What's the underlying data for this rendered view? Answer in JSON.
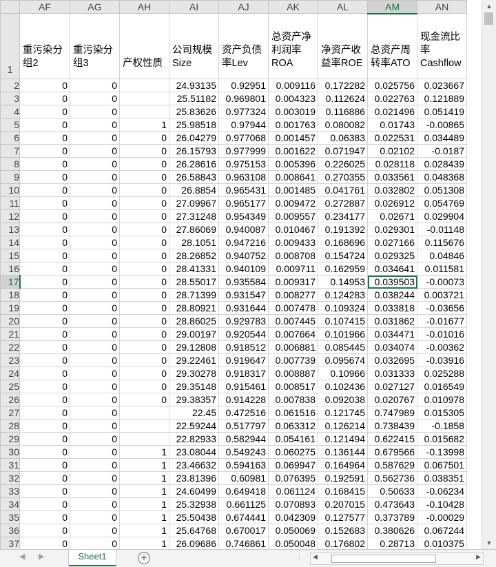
{
  "columns": [
    "AF",
    "AG",
    "AH",
    "AI",
    "AJ",
    "AK",
    "AL",
    "AM",
    "AN"
  ],
  "active_column": "AM",
  "active_row": "17",
  "header_row": {
    "row_label": "1",
    "cells": [
      "重污染分组2",
      "重污染分组3",
      "产权性质",
      "公司规模Size",
      "资产负债率Lev",
      "总资产净利润率ROA",
      "净资产收益率ROE",
      "总资产周转率ATO",
      "现金流比率Cashflow"
    ]
  },
  "rows": [
    {
      "n": "2",
      "cells": [
        "0",
        "0",
        "",
        "24.93135",
        "0.92951",
        "0.009116",
        "0.172282",
        "0.025756",
        "0.023667"
      ]
    },
    {
      "n": "3",
      "cells": [
        "0",
        "0",
        "",
        "25.51182",
        "0.969801",
        "0.004323",
        "0.112624",
        "0.022763",
        "0.121889"
      ]
    },
    {
      "n": "4",
      "cells": [
        "0",
        "0",
        "",
        "25.83626",
        "0.977324",
        "0.003019",
        "0.116886",
        "0.021496",
        "0.051419"
      ]
    },
    {
      "n": "5",
      "cells": [
        "0",
        "0",
        "1",
        "25.98518",
        "0.97944",
        "0.001763",
        "0.080082",
        "0.01743",
        "-0.00865"
      ]
    },
    {
      "n": "6",
      "cells": [
        "0",
        "0",
        "0",
        "26.04279",
        "0.977068",
        "0.001457",
        "0.06383",
        "0.022531",
        "0.034489"
      ]
    },
    {
      "n": "7",
      "cells": [
        "0",
        "0",
        "0",
        "26.15793",
        "0.977999",
        "0.001622",
        "0.071947",
        "0.02102",
        "-0.0187"
      ]
    },
    {
      "n": "8",
      "cells": [
        "0",
        "0",
        "0",
        "26.28616",
        "0.975153",
        "0.005396",
        "0.226025",
        "0.028118",
        "0.028439"
      ]
    },
    {
      "n": "9",
      "cells": [
        "0",
        "0",
        "0",
        "26.58843",
        "0.963108",
        "0.008641",
        "0.270355",
        "0.033561",
        "0.048368"
      ]
    },
    {
      "n": "10",
      "cells": [
        "0",
        "0",
        "0",
        "26.8854",
        "0.965431",
        "0.001485",
        "0.041761",
        "0.032802",
        "0.051308"
      ]
    },
    {
      "n": "11",
      "cells": [
        "0",
        "0",
        "0",
        "27.09967",
        "0.965177",
        "0.009472",
        "0.272887",
        "0.026912",
        "0.054769"
      ]
    },
    {
      "n": "12",
      "cells": [
        "0",
        "0",
        "0",
        "27.31248",
        "0.954349",
        "0.009557",
        "0.234177",
        "0.02671",
        "0.029904"
      ]
    },
    {
      "n": "13",
      "cells": [
        "0",
        "0",
        "0",
        "27.86069",
        "0.940087",
        "0.010467",
        "0.191392",
        "0.029301",
        "-0.01148"
      ]
    },
    {
      "n": "14",
      "cells": [
        "0",
        "0",
        "0",
        "28.1051",
        "0.947216",
        "0.009433",
        "0.168696",
        "0.027166",
        "0.115676"
      ]
    },
    {
      "n": "15",
      "cells": [
        "0",
        "0",
        "0",
        "28.26852",
        "0.940752",
        "0.008708",
        "0.154724",
        "0.029325",
        "0.04846"
      ]
    },
    {
      "n": "16",
      "cells": [
        "0",
        "0",
        "0",
        "28.41331",
        "0.940109",
        "0.009711",
        "0.162959",
        "0.034641",
        "0.011581"
      ]
    },
    {
      "n": "17",
      "cells": [
        "0",
        "0",
        "0",
        "28.55017",
        "0.935584",
        "0.009317",
        "0.14953",
        "0.039503",
        "-0.00073"
      ]
    },
    {
      "n": "18",
      "cells": [
        "0",
        "0",
        "0",
        "28.71399",
        "0.931547",
        "0.008277",
        "0.124283",
        "0.038244",
        "0.003721"
      ]
    },
    {
      "n": "19",
      "cells": [
        "0",
        "0",
        "0",
        "28.80921",
        "0.931644",
        "0.007478",
        "0.109324",
        "0.033818",
        "-0.03656"
      ]
    },
    {
      "n": "20",
      "cells": [
        "0",
        "0",
        "0",
        "28.86025",
        "0.929783",
        "0.007445",
        "0.107415",
        "0.031862",
        "-0.01677"
      ]
    },
    {
      "n": "21",
      "cells": [
        "0",
        "0",
        "0",
        "29.00197",
        "0.920544",
        "0.007664",
        "0.101966",
        "0.034471",
        "-0.01016"
      ]
    },
    {
      "n": "22",
      "cells": [
        "0",
        "0",
        "0",
        "29.12808",
        "0.918512",
        "0.006881",
        "0.085445",
        "0.034074",
        "-0.00362"
      ]
    },
    {
      "n": "23",
      "cells": [
        "0",
        "0",
        "0",
        "29.22461",
        "0.919647",
        "0.007739",
        "0.095674",
        "0.032695",
        "-0.03916"
      ]
    },
    {
      "n": "24",
      "cells": [
        "0",
        "0",
        "0",
        "29.30278",
        "0.918317",
        "0.008887",
        "0.10966",
        "0.031333",
        "0.025288"
      ]
    },
    {
      "n": "25",
      "cells": [
        "0",
        "0",
        "0",
        "29.35148",
        "0.915461",
        "0.008517",
        "0.102436",
        "0.027127",
        "0.016549"
      ]
    },
    {
      "n": "26",
      "cells": [
        "0",
        "0",
        "0",
        "29.38357",
        "0.914228",
        "0.007838",
        "0.092038",
        "0.020767",
        "0.010978"
      ]
    },
    {
      "n": "27",
      "cells": [
        "0",
        "0",
        "",
        "22.45",
        "0.472516",
        "0.061516",
        "0.121745",
        "0.747989",
        "0.015305"
      ]
    },
    {
      "n": "28",
      "cells": [
        "0",
        "0",
        "",
        "22.59244",
        "0.517797",
        "0.063312",
        "0.126214",
        "0.738439",
        "-0.1858"
      ]
    },
    {
      "n": "29",
      "cells": [
        "0",
        "0",
        "",
        "22.82933",
        "0.582944",
        "0.054161",
        "0.121494",
        "0.622415",
        "0.015682"
      ]
    },
    {
      "n": "30",
      "cells": [
        "0",
        "0",
        "1",
        "23.08044",
        "0.549243",
        "0.060275",
        "0.136144",
        "0.679566",
        "-0.13998"
      ]
    },
    {
      "n": "31",
      "cells": [
        "0",
        "0",
        "1",
        "23.46632",
        "0.594163",
        "0.069947",
        "0.164964",
        "0.587629",
        "0.067501"
      ]
    },
    {
      "n": "32",
      "cells": [
        "0",
        "0",
        "1",
        "23.81396",
        "0.60981",
        "0.076395",
        "0.192591",
        "0.562736",
        "0.038351"
      ]
    },
    {
      "n": "33",
      "cells": [
        "0",
        "0",
        "1",
        "24.60499",
        "0.649418",
        "0.061124",
        "0.168415",
        "0.50633",
        "-0.06234"
      ]
    },
    {
      "n": "34",
      "cells": [
        "0",
        "0",
        "1",
        "25.32938",
        "0.661125",
        "0.070893",
        "0.207015",
        "0.473643",
        "-0.10428"
      ]
    },
    {
      "n": "35",
      "cells": [
        "0",
        "0",
        "1",
        "25.50438",
        "0.674441",
        "0.042309",
        "0.127577",
        "0.373789",
        "-0.00029"
      ]
    },
    {
      "n": "36",
      "cells": [
        "0",
        "0",
        "1",
        "25.64768",
        "0.670017",
        "0.050069",
        "0.152683",
        "0.380626",
        "0.067244"
      ]
    },
    {
      "n": "37",
      "cells": [
        "0",
        "0",
        "1",
        "26.09686",
        "0.746861",
        "0.050048",
        "0.176802",
        "0.28713",
        "0.010375"
      ]
    }
  ],
  "sheet_tab": "Sheet1",
  "add_sheet_label": "+",
  "nav_prev": "◀",
  "nav_next": "▶",
  "colors": {
    "accent": "#217346",
    "header_bg": "#e6e6e6",
    "grid": "#d4d4d4"
  }
}
